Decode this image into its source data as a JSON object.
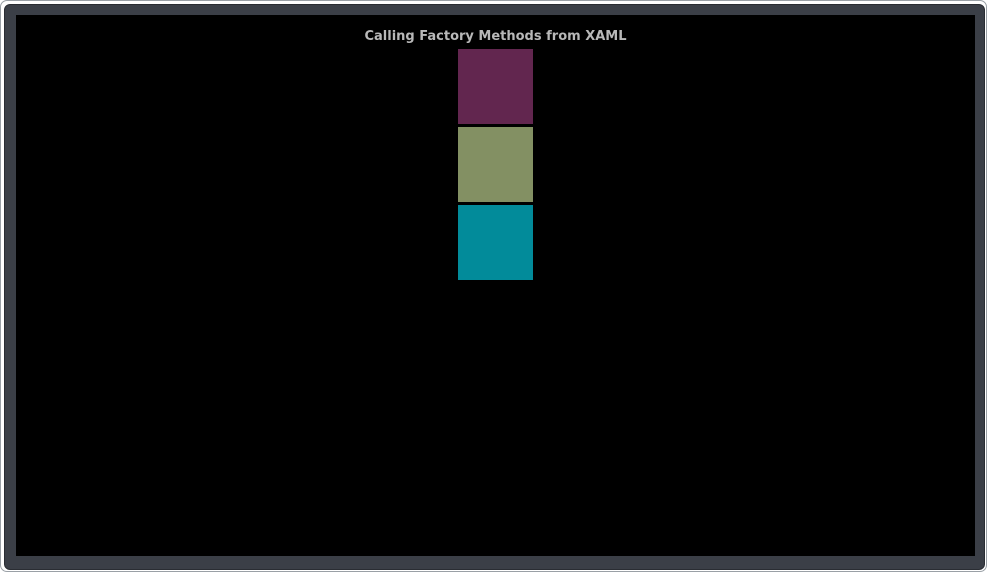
{
  "page": {
    "title": "Calling Factory Methods from XAML"
  },
  "colors": {
    "window_bezel": "#3b3f47",
    "background": "#000000",
    "title_text": "#b8b8b8"
  },
  "swatches": [
    {
      "name": "purple",
      "color": "#62264f"
    },
    {
      "name": "olive-green",
      "color": "#839063"
    },
    {
      "name": "teal",
      "color": "#028b9a"
    }
  ]
}
